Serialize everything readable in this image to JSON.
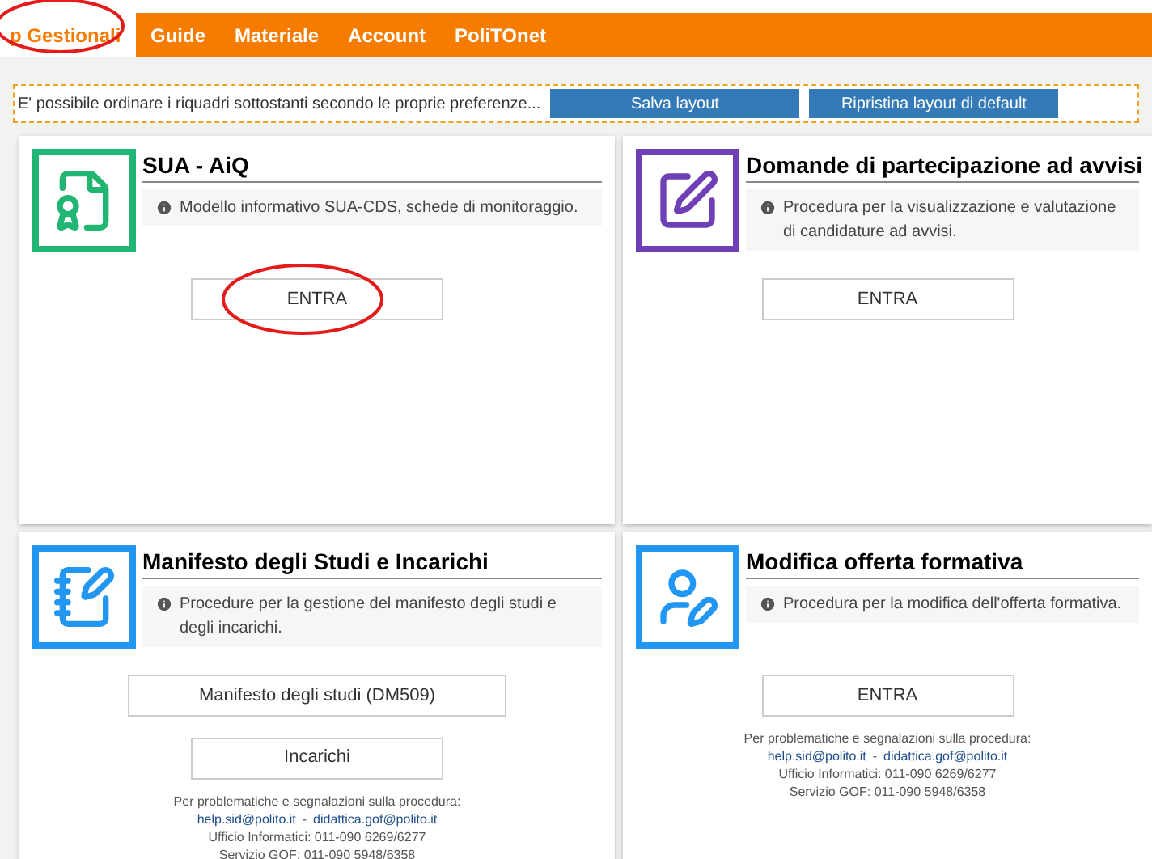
{
  "nav": {
    "tabs": [
      {
        "label": "p Gestionali",
        "selected": true
      },
      {
        "label": "Guide",
        "selected": false
      },
      {
        "label": "Materiale",
        "selected": false
      },
      {
        "label": "Account",
        "selected": false
      },
      {
        "label": "PoliTOnet",
        "selected": false
      }
    ]
  },
  "layout_bar": {
    "text": "E' possibile ordinare i riquadri sottostanti secondo le proprie preferenze...",
    "buttons": [
      "Salva layout",
      "Ripristina layout di default"
    ]
  },
  "cards": [
    {
      "kind": "certificate",
      "color": "#21b573",
      "title": "SUA - AiQ",
      "description": "Modello informativo SUA-CDS, schede di monitoraggio.",
      "buttons": [
        {
          "label": "ENTRA",
          "circled": true
        }
      ]
    },
    {
      "kind": "edit",
      "color": "#6f3fb8",
      "title": "Domande di partecipazione ad avvisi",
      "description": "Procedura per la visualizzazione e valutazione di candidature ad avvisi.",
      "buttons": [
        {
          "label": "ENTRA",
          "circled": false
        }
      ]
    },
    {
      "kind": "notebook",
      "color": "#2196f3",
      "title": "Manifesto degli Studi e Incarichi",
      "description": "Procedure per la gestione del manifesto degli studi e degli incarichi.",
      "buttons": [
        {
          "label": "Manifesto degli studi (DM509)",
          "circled": false
        },
        {
          "label": "Incarichi",
          "circled": false
        }
      ],
      "contact": {
        "intro": "Per problematiche e segnalazioni sulla procedura:",
        "emails": [
          "help.sid@polito.it",
          "didattica.gof@polito.it"
        ],
        "separator": "-",
        "lines": [
          "Ufficio Informatici: 011-090 6269/6277",
          "Servizio GOF: 011-090 5948/6358"
        ]
      }
    },
    {
      "kind": "user",
      "color": "#2196f3",
      "title": "Modifica offerta formativa",
      "description": "Procedura per la modifica dell'offerta formativa.",
      "buttons": [
        {
          "label": "ENTRA",
          "circled": false
        }
      ],
      "contact": {
        "intro": "Per problematiche e segnalazioni sulla procedura:",
        "emails": [
          "help.sid@polito.it",
          "didattica.gof@polito.it"
        ],
        "separator": "-",
        "lines": [
          "Ufficio Informatici: 011-090 6269/6277",
          "Servizio GOF: 011-090 5948/6358"
        ]
      }
    }
  ]
}
